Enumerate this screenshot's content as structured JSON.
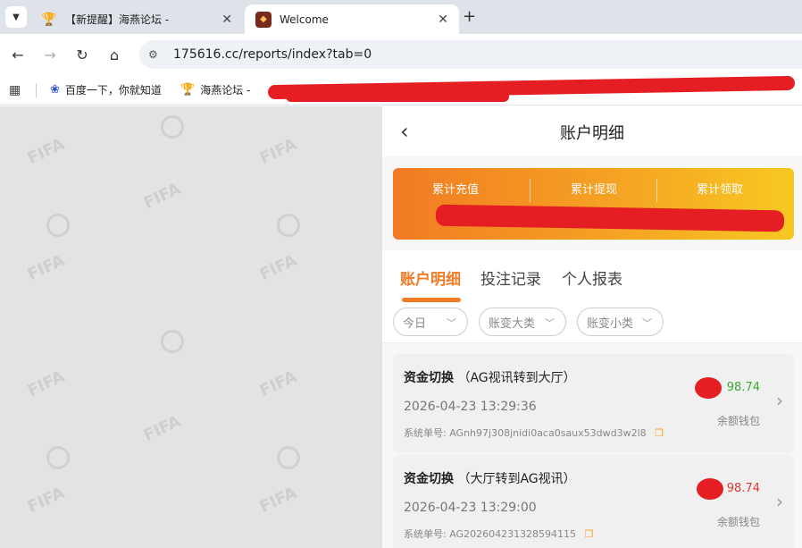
{
  "browser": {
    "tabs": [
      {
        "title": "【新提醒】海燕论坛 -",
        "icon": "trophy-icon",
        "active": false
      },
      {
        "title": "Welcome",
        "icon": "app-logo-icon",
        "active": true
      }
    ],
    "new_tab_label": "+",
    "url": "175616.cc/reports/index?tab=0",
    "bookmarks": [
      {
        "label": "百度一下，你就知道",
        "icon": "baidu-paw-icon"
      },
      {
        "label": "海燕论坛 -",
        "icon": "trophy-icon"
      }
    ]
  },
  "app": {
    "header": {
      "title": "账户明细"
    },
    "summary": {
      "columns": [
        "累计充值",
        "累计提现",
        "累计领取"
      ]
    },
    "tabs": [
      "账户明细",
      "投注记录",
      "个人报表"
    ],
    "active_tab": 0,
    "filters": [
      "今日",
      "账变大类",
      "账变小类"
    ],
    "records": [
      {
        "title": "资金切换",
        "subtitle": "（AG视讯转到大厅）",
        "time": "2026-04-23 13:29:36",
        "order_label": "系统单号:",
        "order_no": "AGnh97j308jnidi0aca0saux53dwd3w2l8",
        "amount": "98.74",
        "amount_color": "#3aaa35",
        "wallet": "余额钱包"
      },
      {
        "title": "资金切换",
        "subtitle": "（大厅转到AG视讯）",
        "time": "2026-04-23 13:29:00",
        "order_label": "系统单号:",
        "order_no": "AG202604231328594115",
        "amount": "98.74",
        "amount_color": "#e33a2e",
        "wallet": "余额钱包"
      }
    ]
  },
  "colors": {
    "accent": "#f27b23",
    "redaction": "#e41e22"
  }
}
